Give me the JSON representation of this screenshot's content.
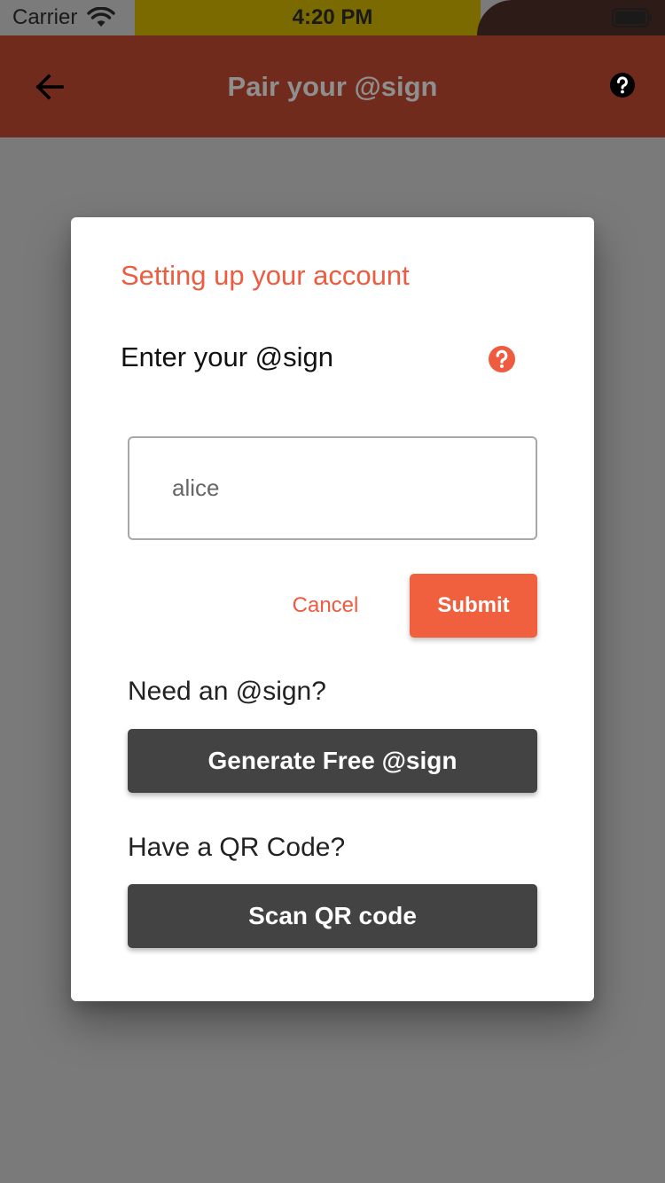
{
  "status_bar": {
    "carrier": "Carrier",
    "time": "4:20 PM",
    "icons": [
      "wifi-icon",
      "battery-icon"
    ]
  },
  "app_bar": {
    "title": "Pair your @sign",
    "back_icon": "arrow-left-icon",
    "help_icon": "help-circle-icon"
  },
  "dialog": {
    "title": "Setting up your account",
    "field_label": "Enter your @sign",
    "field_help_icon": "help-circle-icon",
    "input": {
      "value": "",
      "placeholder": "alice"
    },
    "cancel_label": "Cancel",
    "submit_label": "Submit",
    "need_sign_label": "Need an @sign?",
    "generate_label": "Generate Free @sign",
    "qr_label": "Have a QR Code?",
    "scan_label": "Scan QR code"
  },
  "colors": {
    "accent": "#ef5b3f",
    "app_bar": "#712b1d",
    "dark_button": "#434343",
    "overlay": "#7a7a7a"
  }
}
